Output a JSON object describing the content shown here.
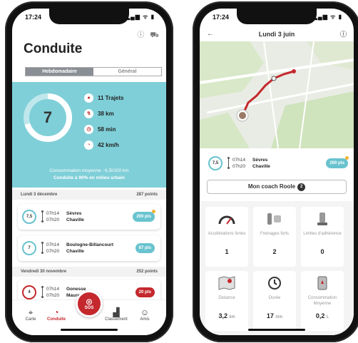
{
  "status": {
    "time": "17:24",
    "icons": "▂▄▆ ᯤ ▮"
  },
  "left": {
    "title": "Conduite",
    "segments": [
      "Hebdomadaire",
      "Général"
    ],
    "score": "7",
    "stats": [
      {
        "icon": "pin-icon",
        "glyph": "●",
        "text": "11 Trajets"
      },
      {
        "icon": "route-icon",
        "glyph": "↯",
        "text": "38 km"
      },
      {
        "icon": "clock-icon",
        "glyph": "◷",
        "text": "58 min"
      },
      {
        "icon": "speedometer-icon",
        "glyph": "◔",
        "text": "42 km/h"
      }
    ],
    "conso_line": "Consommation moyenne : 6,5l/100 km",
    "urban_line": "Conduite à 90% en milieu urbain",
    "sections": [
      {
        "date": "Lundi 3 décembre",
        "points": "287 points"
      },
      {
        "date": "Vendredi 30 novembre",
        "points": "252 points"
      }
    ],
    "trips": [
      {
        "score": "7,5",
        "t1": "07h14",
        "t2": "07h20",
        "p1": "Sèvres",
        "p2": "Chaville",
        "pts": "200 pts"
      },
      {
        "score": "7",
        "t1": "07h14",
        "t2": "07h20",
        "p1": "Boulogne-Billancourt",
        "p2": "Chaville",
        "pts": "87 pts"
      },
      {
        "score": "4",
        "t1": "07h14",
        "t2": "07h20",
        "p1": "Gonesse",
        "p2": "Mauregard",
        "pts": "20 pts"
      }
    ],
    "tabs": [
      "Carte",
      "Conduite",
      "SOS",
      "Classement",
      "Amis"
    ]
  },
  "right": {
    "title": "Lundi 3 juin",
    "trip": {
      "score": "7,5",
      "t1": "07h14",
      "t2": "07h20",
      "p1": "Sèvres",
      "p2": "Chaville",
      "pts": "200 pts"
    },
    "coach": "Mon coach Roole",
    "coach_badge": "2",
    "tiles": [
      {
        "label": "Accélérations fortes",
        "value": "1",
        "unit": ""
      },
      {
        "label": "Freinages forts",
        "value": "2",
        "unit": ""
      },
      {
        "label": "Limites d'adhérence",
        "value": "0",
        "unit": ""
      },
      {
        "label": "Distance",
        "value": "3,2",
        "unit": "km"
      },
      {
        "label": "Durée",
        "value": "17",
        "unit": "min"
      },
      {
        "label": "Consommation Moyenne",
        "value": "0,2",
        "unit": "L"
      }
    ]
  },
  "colors": {
    "accent": "#c4282d",
    "teal": "#7fcfd8",
    "badge": "#69c3cf"
  }
}
